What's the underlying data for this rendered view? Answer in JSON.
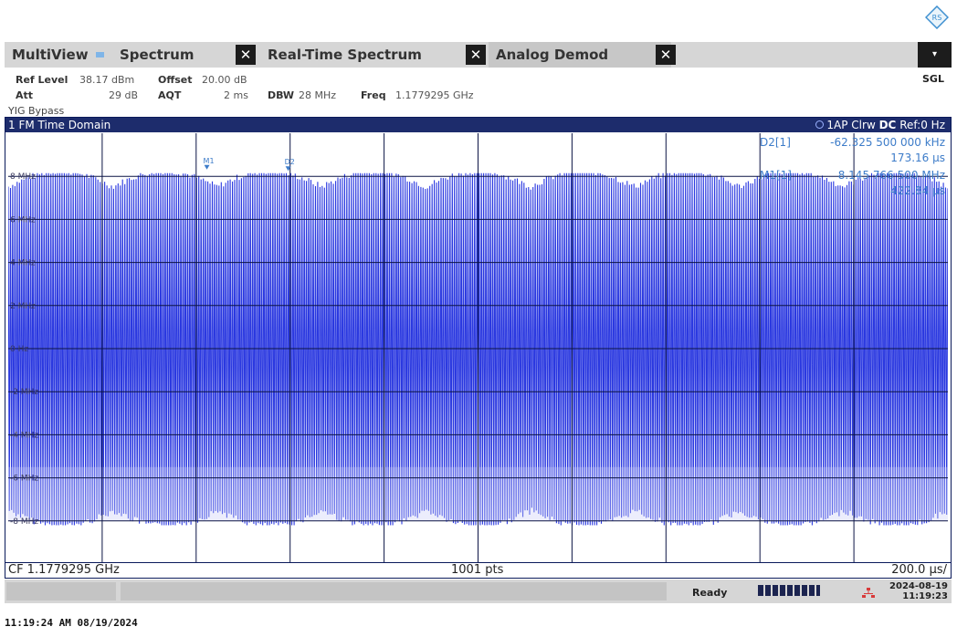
{
  "brand": {
    "logo": "RS"
  },
  "tabs": {
    "multiview": "MultiView",
    "spectrum": "Spectrum",
    "realtime": "Real-Time Spectrum",
    "analog": "Analog Demod",
    "close_glyph": "✕",
    "menu_glyph": "▾"
  },
  "mode": "SGL",
  "settings": {
    "ref_level_label": "Ref Level",
    "ref_level_value": "38.17 dBm",
    "offset_label": "Offset",
    "offset_value": "20.00 dB",
    "att_label": "Att",
    "att_value": "29 dB",
    "aqt_label": "AQT",
    "aqt_value": "2 ms",
    "dbw_label": "DBW",
    "dbw_value": "28 MHz",
    "freq_label": "Freq",
    "freq_value": "1.1779295 GHz",
    "yig": "YIG Bypass"
  },
  "diagram": {
    "title": "1 FM Time Domain",
    "trace_marker": "1AP Clrw",
    "dc": "DC",
    "ref": "Ref:0 Hz",
    "cf": "CF 1.1779295 GHz",
    "pts": "1001 pts",
    "div": "200.0 µs/"
  },
  "chart_data": {
    "type": "line",
    "title": "1 FM Time Domain",
    "xlabel": "",
    "ylabel": "",
    "y_ticks": [
      "8 MHz",
      "6 MHz",
      "4 MHz",
      "2 MHz",
      "0 Hz",
      "-2 MHz",
      "-4 MHz",
      "-6 MHz",
      "-8 MHz"
    ],
    "y_tick_values": [
      8,
      6,
      4,
      2,
      0,
      -2,
      -4,
      -6,
      -8
    ],
    "ylim": [
      -10,
      10
    ],
    "xlim": [
      0,
      2000
    ],
    "x_unit": "µs",
    "y_unit": "MHz",
    "num_points": 1001,
    "trace_summary": {
      "max_MHz": 8.15,
      "min_MHz": -8.2,
      "note": "dense FM deviation oscillation"
    },
    "series": [
      {
        "name": "1AP Clrw",
        "color": "#2a38e0"
      }
    ],
    "markers": [
      {
        "name": "M1",
        "x_us": 422.84,
        "y_MHz": 8.1457665
      },
      {
        "name": "D2",
        "x_us": 596.0,
        "y_MHz": 8.0834
      }
    ]
  },
  "markers_table": [
    {
      "label": "D2[1]",
      "value": "-62.325 500 000 kHz",
      "time": "173.16 µs"
    },
    {
      "label": "M1[1]",
      "value": "8.145 766 500 MHz",
      "time": "422.84 µs"
    }
  ],
  "status": {
    "ready": "Ready",
    "date": "2024-08-19",
    "time": "11:19:23"
  },
  "footer": "11:19:24 AM 08/19/2024",
  "colors": {
    "trace": "#2a38e0",
    "marker": "#3d7cc9",
    "title_bar": "#1d2c6c",
    "grid": "#0c1445"
  }
}
